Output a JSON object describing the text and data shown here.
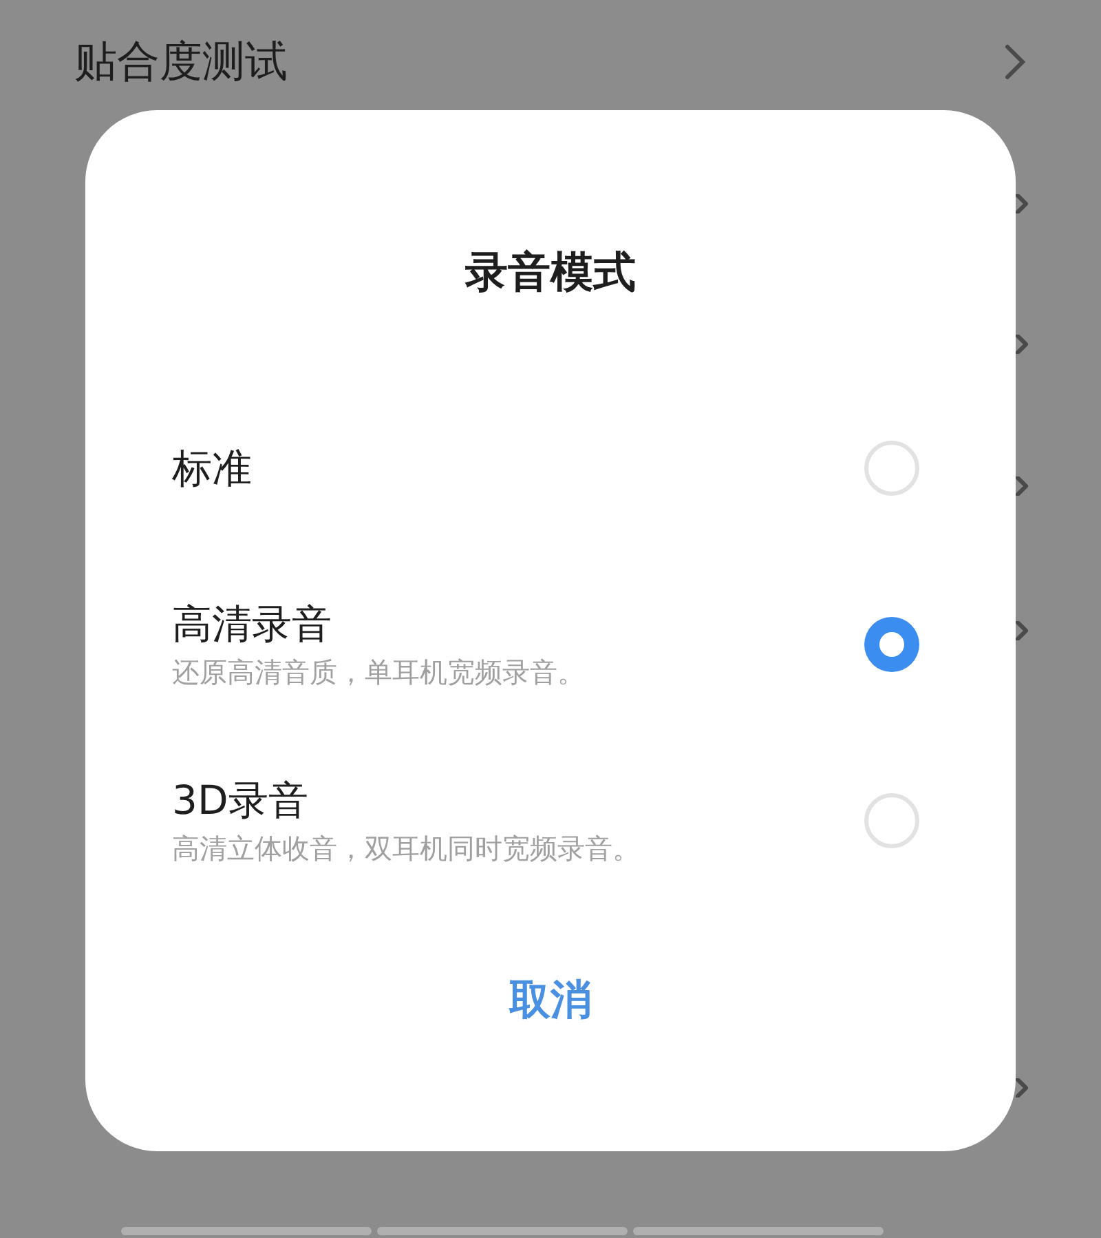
{
  "background_row": {
    "title": "贴合度测试"
  },
  "dialog": {
    "title": "录音模式",
    "options": [
      {
        "label": "标准",
        "selected": false
      },
      {
        "label": "高清录音",
        "description": "还原高清音质，单耳机宽频录音。",
        "selected": true
      },
      {
        "label": "3D录音",
        "description": "高清立体收音，双耳机同时宽频录音。",
        "selected": false
      }
    ],
    "cancel": "取消"
  }
}
